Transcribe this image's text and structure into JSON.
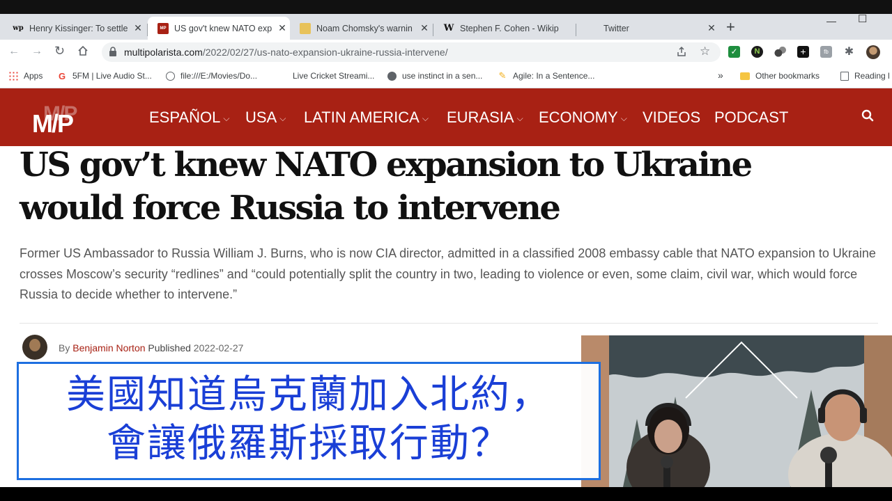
{
  "tabs": [
    {
      "favicon": "wp",
      "title": "Henry Kissinger: To settle",
      "active": false
    },
    {
      "favicon": "MP",
      "title": "US gov't knew NATO exp",
      "active": true
    },
    {
      "favicon": "",
      "title": "Noam Chomsky's warnin",
      "active": false
    },
    {
      "favicon": "W",
      "title": "Stephen F. Cohen - Wikip",
      "active": false
    },
    {
      "favicon": "",
      "title": "Twitter",
      "active": false
    }
  ],
  "omnibar": {
    "url_host": "multipolarista.com",
    "url_path": "/2022/02/27/us-nato-expansion-ukraine-russia-intervene/"
  },
  "bookmarks": {
    "items": [
      {
        "label": "Apps"
      },
      {
        "label": "5FM | Live Audio St..."
      },
      {
        "label": "file:///E:/Movies/Do..."
      },
      {
        "label": "Live Cricket Streami..."
      },
      {
        "label": "use instinct in a sen..."
      },
      {
        "label": "Agile: In a Sentence..."
      }
    ],
    "overflow": "»",
    "other": "Other bookmarks",
    "reading": "Reading l"
  },
  "site": {
    "logo": "M/P",
    "menu": [
      {
        "label": "ESPAÑOL",
        "dropdown": true
      },
      {
        "label": "USA",
        "dropdown": true
      },
      {
        "label": "LATIN AMERICA",
        "dropdown": true
      },
      {
        "label": "EURASIA",
        "dropdown": true
      },
      {
        "label": "ECONOMY",
        "dropdown": true
      },
      {
        "label": "VIDEOS",
        "dropdown": false
      },
      {
        "label": "PODCAST",
        "dropdown": false
      }
    ]
  },
  "article": {
    "headline": "US gov’t knew NATO expansion to Ukraine would force Russia to intervene",
    "summary": "Former US Ambassador to Russia William J. Burns, who is now CIA director, admitted in a classified 2008 embassy cable that NATO expansion to Ukraine crosses Moscow’s security “redlines” and “could potentially split the country in two, leading to violence or even, some claim, civil war, which would force Russia to decide whether to intervene.”",
    "by_label": "By",
    "author": "Benjamin Norton",
    "published_label": "Published",
    "date": "2022-02-27"
  },
  "overlay": {
    "line1": "美國知道烏克蘭加入北約，",
    "line2": "會讓俄羅斯採取行動？"
  }
}
